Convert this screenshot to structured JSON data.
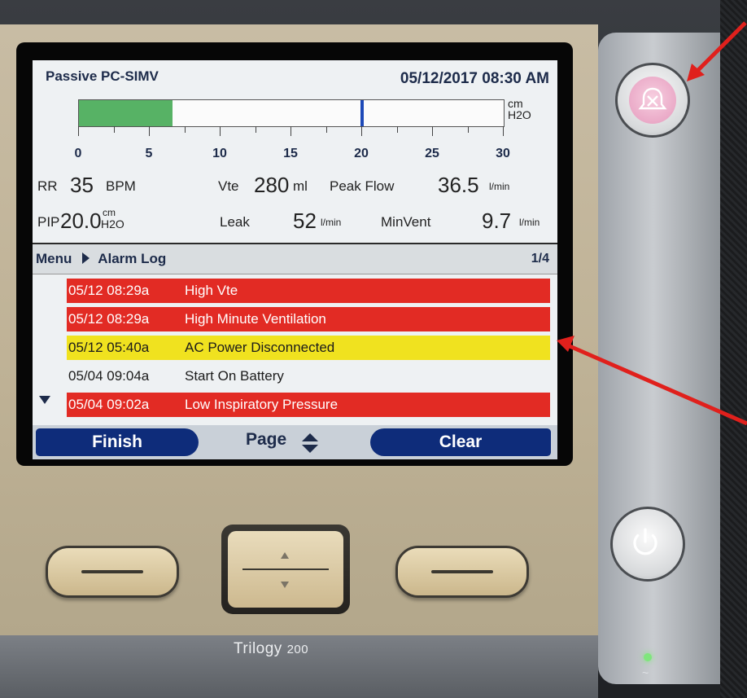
{
  "header": {
    "mode": "Passive PC-SIMV",
    "datetime": "05/12/2017 08:30 AM"
  },
  "pressure_gauge": {
    "unit_line1": "cm",
    "unit_line2": "H2O",
    "scale": [
      "0",
      "5",
      "10",
      "15",
      "20",
      "25",
      "30"
    ],
    "range": [
      0,
      30
    ],
    "fill_value": 6.6,
    "marker_value": 20,
    "fill_color": "#57b265",
    "marker_color": "#1d49b8"
  },
  "parameters": {
    "rr_label": "RR",
    "rr_value": "35",
    "rr_unit": "BPM",
    "vte_label": "Vte",
    "vte_value": "280",
    "vte_unit": "ml",
    "peakflow_label": "Peak Flow",
    "peakflow_value": "36.5",
    "peakflow_unit": "l/min",
    "pip_label": "PIP",
    "pip_value": "20.0",
    "pip_unit_top": "cm",
    "pip_unit_bottom": "H2O",
    "leak_label": "Leak",
    "leak_value": "52",
    "leak_unit": "l/min",
    "minvent_label": "MinVent",
    "minvent_value": "9.7",
    "minvent_unit": "l/min"
  },
  "menu": {
    "root": "Menu",
    "current": "Alarm Log",
    "page": "1/4"
  },
  "alarms": [
    {
      "time": "05/12 08:29a",
      "message": "High Vte",
      "level": "high",
      "color": "#e22b24"
    },
    {
      "time": "05/12 08:29a",
      "message": "High Minute Ventilation",
      "level": "high",
      "color": "#e22b24"
    },
    {
      "time": "05/12 05:40a",
      "message": "AC Power Disconnected",
      "level": "medium",
      "color": "#f0e21f"
    },
    {
      "time": "05/04 09:04a",
      "message": "Start On Battery",
      "level": "info",
      "color": "#eef1f3"
    },
    {
      "time": "05/04 09:02a",
      "message": "Low Inspiratory Pressure",
      "level": "high",
      "color": "#e22b24"
    }
  ],
  "softkeys": {
    "left": "Finish",
    "center": "Page",
    "right": "Clear"
  },
  "device": {
    "brand": "Trilogy",
    "model": "200",
    "status_symbol": "~"
  },
  "icons": {
    "alarm_silence": "alarm-silence-icon",
    "power": "power-icon",
    "scroll_down": "triangle-down-icon",
    "page_updown": "up-down-arrows-icon"
  },
  "annotation_color": "#e0201c"
}
